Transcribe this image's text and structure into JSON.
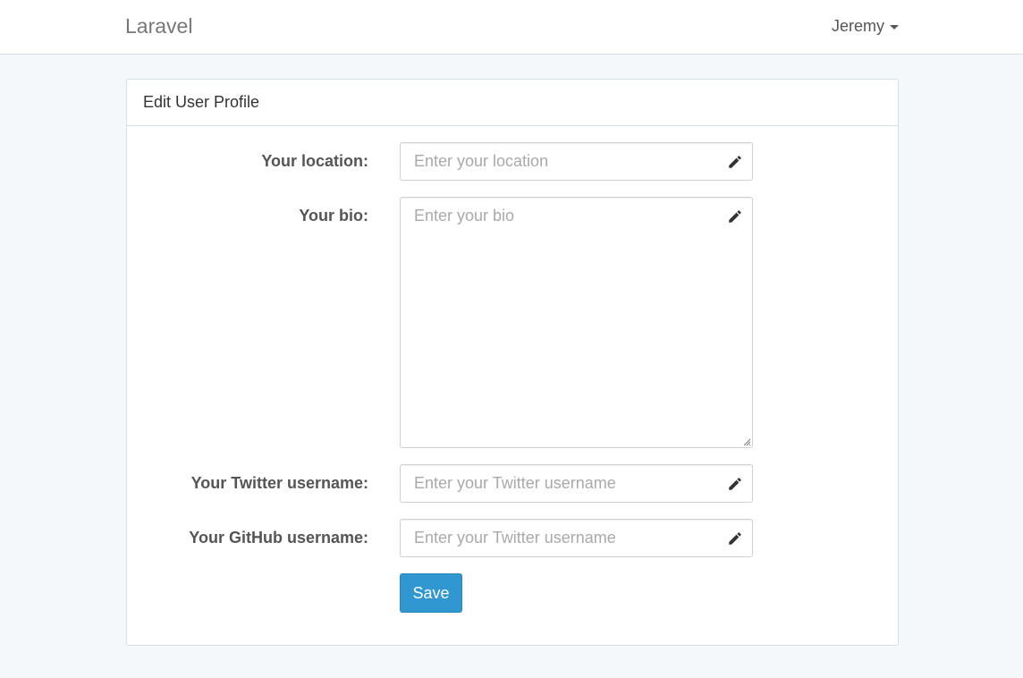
{
  "navbar": {
    "brand": "Laravel",
    "user_name": "Jeremy"
  },
  "panel": {
    "title": "Edit User Profile"
  },
  "form": {
    "location": {
      "label": "Your location:",
      "placeholder": "Enter your location",
      "value": ""
    },
    "bio": {
      "label": "Your bio:",
      "placeholder": "Enter your bio",
      "value": ""
    },
    "twitter": {
      "label": "Your Twitter username:",
      "placeholder": "Enter your Twitter username",
      "value": ""
    },
    "github": {
      "label": "Your GitHub username:",
      "placeholder": "Enter your Twitter username",
      "value": ""
    },
    "save_label": "Save"
  },
  "icons": {
    "field_action": "pencil-icon",
    "user_menu": "caret-down-icon"
  },
  "colors": {
    "background": "#f5f8fa",
    "primary": "#3097d1",
    "border": "#d3e0e9"
  }
}
